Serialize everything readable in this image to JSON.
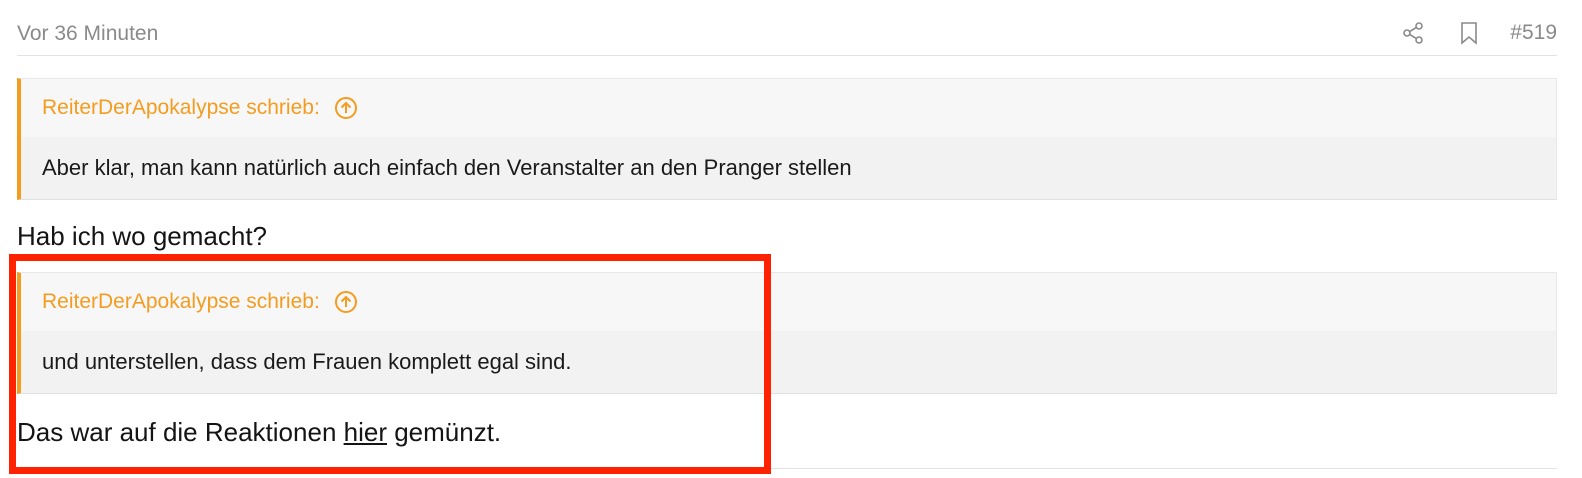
{
  "post": {
    "timestamp": "Vor 36 Minuten",
    "number": "#519",
    "icons": {
      "share": "share-icon",
      "bookmark": "bookmark-icon"
    }
  },
  "quotes": [
    {
      "author": "ReiterDerApokalypse schrieb:",
      "text": "Aber klar, man kann natürlich auch einfach den Veranstalter an den Pranger stellen"
    },
    {
      "author": "ReiterDerApokalypse schrieb:",
      "text": "und unterstellen, dass dem Frauen komplett egal sind."
    }
  ],
  "replies": {
    "first": "Hab ich wo gemacht?",
    "second_before": "Das war auf die Reaktionen ",
    "second_link": "hier",
    "second_after": " gemünzt."
  },
  "colors": {
    "accent": "#f39c1f",
    "highlight": "#ff2200",
    "muted_text": "#8a8a8a"
  }
}
